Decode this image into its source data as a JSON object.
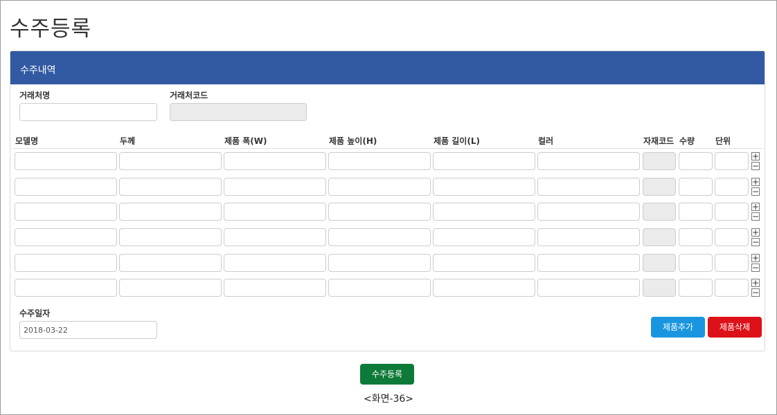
{
  "page_title": "수주등록",
  "panel": {
    "title": "수주내역",
    "client_name_label": "거래처명",
    "client_name_value": "",
    "client_code_label": "거래처코드",
    "client_code_value": ""
  },
  "table": {
    "columns": [
      "모델명",
      "두께",
      "제품 폭(W)",
      "제품 높이(H)",
      "제품 길이(L)",
      "컬러",
      "자재코드",
      "수량",
      "단위"
    ],
    "rows": [
      {
        "model": "",
        "thickness": "",
        "width": "",
        "height": "",
        "length": "",
        "color": "",
        "material_code": "",
        "qty": "",
        "unit": ""
      },
      {
        "model": "",
        "thickness": "",
        "width": "",
        "height": "",
        "length": "",
        "color": "",
        "material_code": "",
        "qty": "",
        "unit": ""
      },
      {
        "model": "",
        "thickness": "",
        "width": "",
        "height": "",
        "length": "",
        "color": "",
        "material_code": "",
        "qty": "",
        "unit": ""
      },
      {
        "model": "",
        "thickness": "",
        "width": "",
        "height": "",
        "length": "",
        "color": "",
        "material_code": "",
        "qty": "",
        "unit": ""
      },
      {
        "model": "",
        "thickness": "",
        "width": "",
        "height": "",
        "length": "",
        "color": "",
        "material_code": "",
        "qty": "",
        "unit": ""
      },
      {
        "model": "",
        "thickness": "",
        "width": "",
        "height": "",
        "length": "",
        "color": "",
        "material_code": "",
        "qty": "",
        "unit": ""
      }
    ],
    "add_row_symbol": "+",
    "remove_row_symbol": "−"
  },
  "order_date": {
    "label": "수주일자",
    "value": "2018-03-22"
  },
  "buttons": {
    "add_product": "제품추가",
    "delete_product": "제품삭제",
    "register_order": "수주등록"
  },
  "caption": "<화면-36>",
  "colors": {
    "panel_header": "#325aa3",
    "add_button": "#1a96e0",
    "delete_button": "#dd1118",
    "submit_button": "#0e7a3a"
  }
}
